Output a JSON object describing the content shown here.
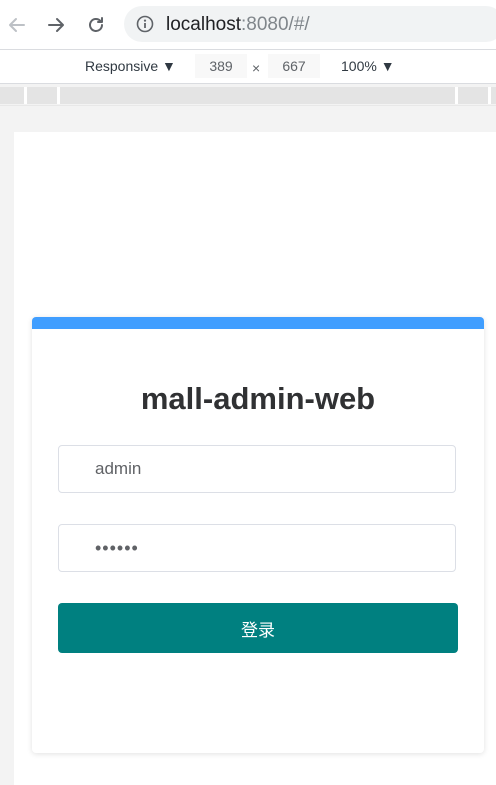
{
  "browser": {
    "url_host": "localhost",
    "url_rest": ":8080/#/"
  },
  "devtools": {
    "device": "Responsive ▼",
    "width": "389",
    "times": "×",
    "height": "667",
    "zoom": "100% ▼"
  },
  "login": {
    "title": "mall-admin-web",
    "username_value": "admin",
    "password_value": "123456",
    "submit_label": "登录"
  },
  "colors": {
    "accent": "#409eff",
    "button": "#008080"
  },
  "icons": {
    "back": "arrow-left-icon",
    "forward": "arrow-right-icon",
    "reload": "reload-icon",
    "site_info": "info-circle-icon"
  }
}
